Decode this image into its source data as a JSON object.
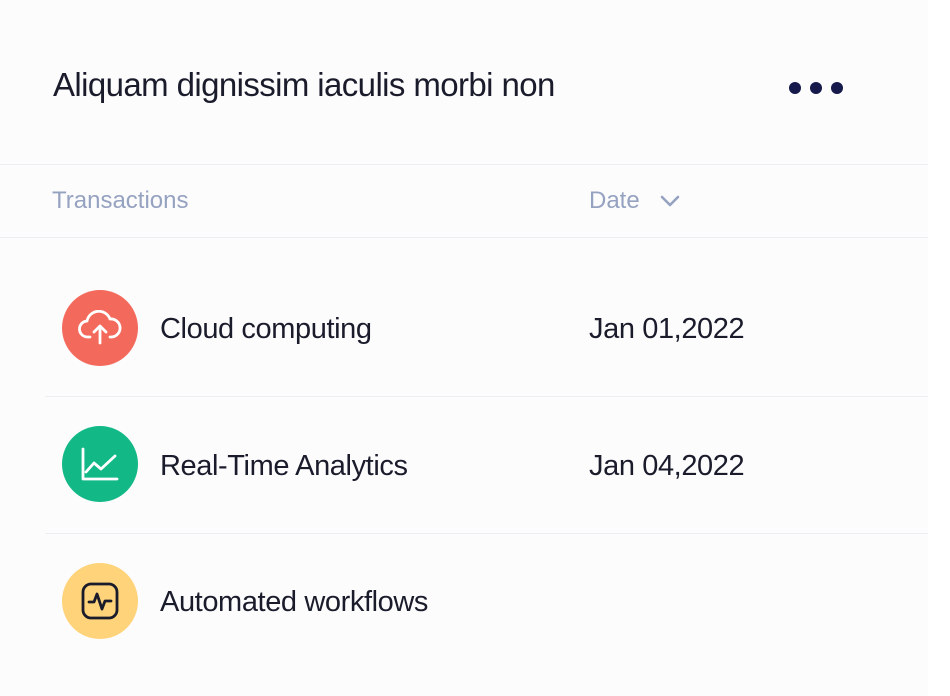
{
  "header": {
    "title": "Aliquam dignissim iaculis morbi non",
    "more_icon": "more-horizontal-icon"
  },
  "table": {
    "columns": {
      "transactions": "Transactions",
      "date": "Date"
    },
    "sort_icon": "chevron-down-icon",
    "rows": [
      {
        "name": "Cloud computing",
        "date": "Jan 01,2022",
        "icon": "cloud-upload-icon",
        "icon_bg": "#f36a5c"
      },
      {
        "name": "Real-Time Analytics",
        "date": "Jan 04,2022",
        "icon": "line-chart-icon",
        "icon_bg": "#12b886"
      },
      {
        "name": "Automated workflows",
        "date": "",
        "icon": "activity-square-icon",
        "icon_bg": "#ffd37a"
      }
    ]
  },
  "colors": {
    "muted_text": "#95a2c0",
    "primary_text": "#1a1b2b",
    "dots": "#151a4a",
    "divider": "#eceef2"
  }
}
